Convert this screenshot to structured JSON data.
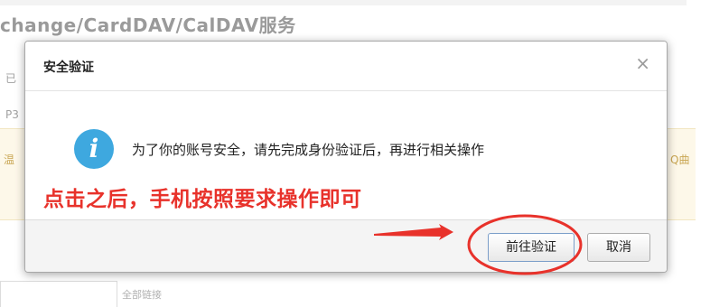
{
  "background": {
    "title": "change/CardDAV/CalDAV服务",
    "frag_left_1": "已",
    "frag_left_2": "P3",
    "frag_left_3": "温",
    "frag_right": "Q曲",
    "bottom_frag": "全部链接"
  },
  "dialog": {
    "title": "安全验证",
    "close_glyph": "×",
    "info_glyph": "i",
    "message": "为了你的账号安全，请先完成身份验证后，再进行相关操作",
    "annotation": "点击之后，手机按照要求操作即可",
    "primary_button": "前往验证",
    "cancel_button": "取消"
  },
  "colors": {
    "annotation": "#e8322b",
    "info_icon": "#3ea8df",
    "highlight_circle": "#e8322b"
  }
}
